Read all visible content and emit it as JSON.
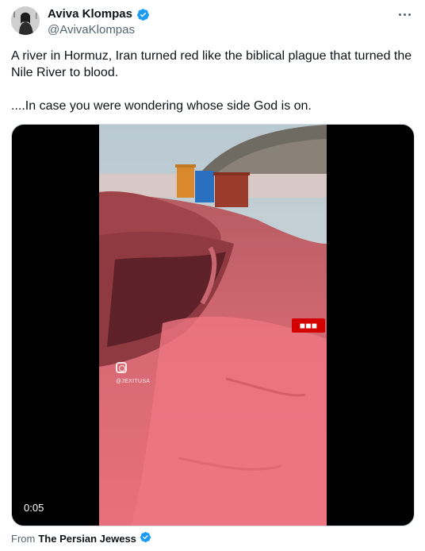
{
  "author": {
    "display_name": "Aviva Klompas",
    "handle": "@AvivaKlompas",
    "verified_color": "#1d9bf0"
  },
  "more_icon": "more-horizontal-icon",
  "tweet": {
    "paragraph_1": "A river in Hormuz, Iran turned red like the biblical plague that turned the Nile River to blood.",
    "paragraph_2": "....In case you were wondering whose side God is on."
  },
  "media": {
    "timestamp": "0:05",
    "watermark_username": "@JEXITUSA"
  },
  "source": {
    "prefix": "From",
    "name": "The Persian Jewess"
  }
}
